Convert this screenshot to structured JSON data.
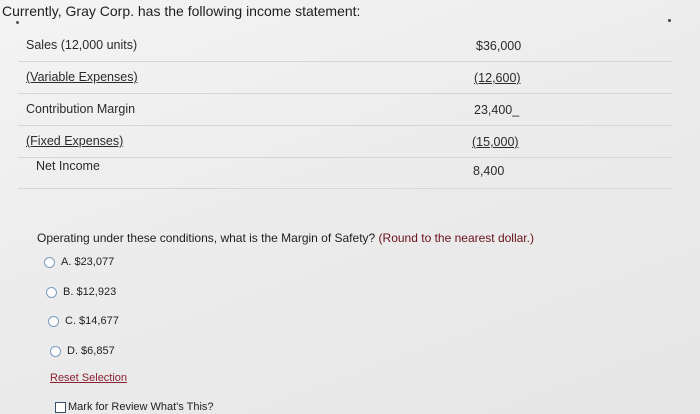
{
  "intro": "Currently, Gray Corp. has the following income statement:",
  "income_statement": {
    "rows": [
      {
        "label": "Sales (12,000 units)",
        "value": "$36,000"
      },
      {
        "label": "(Variable Expenses)",
        "value": "(12,600)"
      },
      {
        "label": "Contribution Margin",
        "value": "23,400_"
      },
      {
        "label": "(Fixed Expenses)",
        "value": "(15,000)"
      },
      {
        "label": "Net Income",
        "value": "8,400"
      }
    ]
  },
  "question": {
    "text": "Operating under these conditions, what is the Margin of Safety?",
    "note": "(Round to the nearest dollar.)",
    "options": [
      {
        "label": "A. $23,077"
      },
      {
        "label": "B. $12,923"
      },
      {
        "label": "C. $14,677"
      },
      {
        "label": "D. $6,857"
      }
    ]
  },
  "reset_label": "Reset Selection",
  "review_label": "Mark for Review What's This?",
  "colors": {
    "background": "#ececec",
    "link": "#8a2230",
    "radio_border": "#7c9bbd",
    "divider": "#d6d6d6"
  }
}
